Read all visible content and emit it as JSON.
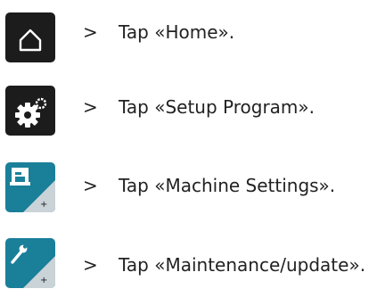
{
  "steps": [
    {
      "icon": "home-icon",
      "arrow": ">",
      "text": "Tap «Home»."
    },
    {
      "icon": "gears-icon",
      "arrow": ">",
      "text": "Tap «Setup Program»."
    },
    {
      "icon": "sewing-machine-icon",
      "arrow": ">",
      "text": "Tap «Machine Settings»."
    },
    {
      "icon": "wrench-icon",
      "arrow": ">",
      "text": "Tap «Maintenance/update»."
    }
  ],
  "colors": {
    "dark_button": "#1c1c1c",
    "blue_button": "#1a7f99",
    "text": "#222222"
  }
}
